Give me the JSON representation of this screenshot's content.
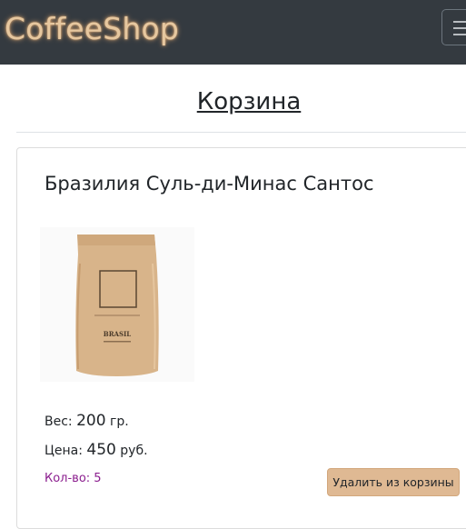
{
  "navbar": {
    "brand": "CoffeeShop",
    "menu_icon": "hamburger-menu-icon"
  },
  "page": {
    "title": "Корзина"
  },
  "cart": {
    "items": [
      {
        "name": "Бразилия Суль-ди-Минас Сантос",
        "image_icon": "coffee-bag-image",
        "package_label": "BRASIL",
        "weight_label": "Вес:",
        "weight_value": "200",
        "weight_unit": "гр.",
        "price_label": "Цена:",
        "price_value": "450",
        "price_unit": "руб.",
        "quantity_label": "Кол-во: 5",
        "remove_label": "Удалить из корзины"
      }
    ]
  },
  "colors": {
    "navbar_bg": "#343a40",
    "brand": "#e6c79f",
    "remove_button": "#dfb993",
    "quantity_text": "#8b1d8e"
  }
}
